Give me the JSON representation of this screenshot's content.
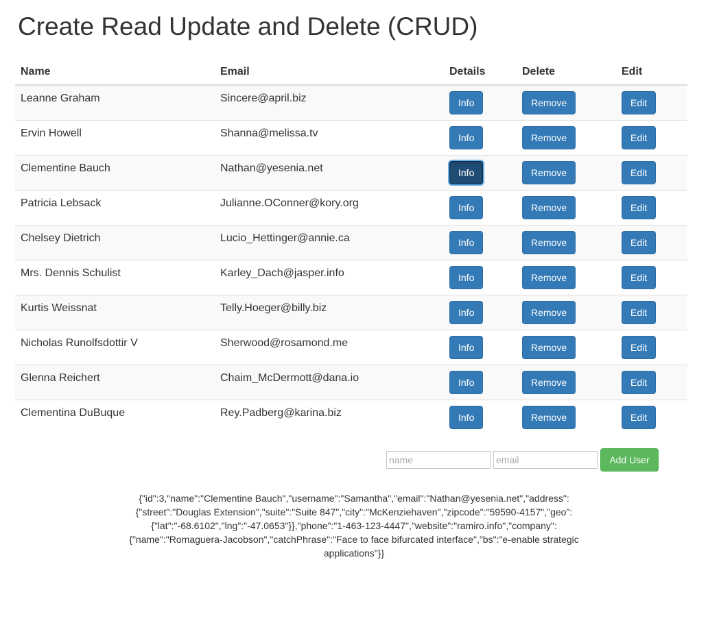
{
  "page": {
    "title": "Create Read Update and Delete (CRUD)"
  },
  "table": {
    "headers": {
      "name": "Name",
      "email": "Email",
      "details": "Details",
      "delete": "Delete",
      "edit": "Edit"
    },
    "buttons": {
      "info": "Info",
      "remove": "Remove",
      "edit": "Edit"
    },
    "rows": [
      {
        "name": "Leanne Graham",
        "email": "Sincere@april.biz"
      },
      {
        "name": "Ervin Howell",
        "email": "Shanna@melissa.tv"
      },
      {
        "name": "Clementine Bauch",
        "email": "Nathan@yesenia.net"
      },
      {
        "name": "Patricia Lebsack",
        "email": "Julianne.OConner@kory.org"
      },
      {
        "name": "Chelsey Dietrich",
        "email": "Lucio_Hettinger@annie.ca"
      },
      {
        "name": "Mrs. Dennis Schulist",
        "email": "Karley_Dach@jasper.info"
      },
      {
        "name": "Kurtis Weissnat",
        "email": "Telly.Hoeger@billy.biz"
      },
      {
        "name": "Nicholas Runolfsdottir V",
        "email": "Sherwood@rosamond.me"
      },
      {
        "name": "Glenna Reichert",
        "email": "Chaim_McDermott@dana.io"
      },
      {
        "name": "Clementina DuBuque",
        "email": "Rey.Padberg@karina.biz"
      }
    ],
    "focused_info_row": 2
  },
  "add_user_form": {
    "name_value": "",
    "name_placeholder": "name",
    "email_value": "",
    "email_placeholder": "email",
    "submit_label": "Add User"
  },
  "colors": {
    "primary": "#337ab7",
    "primary_focused": "#204d74",
    "success": "#5cb85c",
    "stripe": "#f9f9f9"
  },
  "details_output": "{\"id\":3,\"name\":\"Clementine Bauch\",\"username\":\"Samantha\",\"email\":\"Nathan@yesenia.net\",\"address\":{\"street\":\"Douglas Extension\",\"suite\":\"Suite 847\",\"city\":\"McKenziehaven\",\"zipcode\":\"59590-4157\",\"geo\":{\"lat\":\"-68.6102\",\"lng\":\"-47.0653\"}},\"phone\":\"1-463-123-4447\",\"website\":\"ramiro.info\",\"company\":{\"name\":\"Romaguera-Jacobson\",\"catchPhrase\":\"Face to face bifurcated interface\",\"bs\":\"e-enable strategic applications\"}}"
}
